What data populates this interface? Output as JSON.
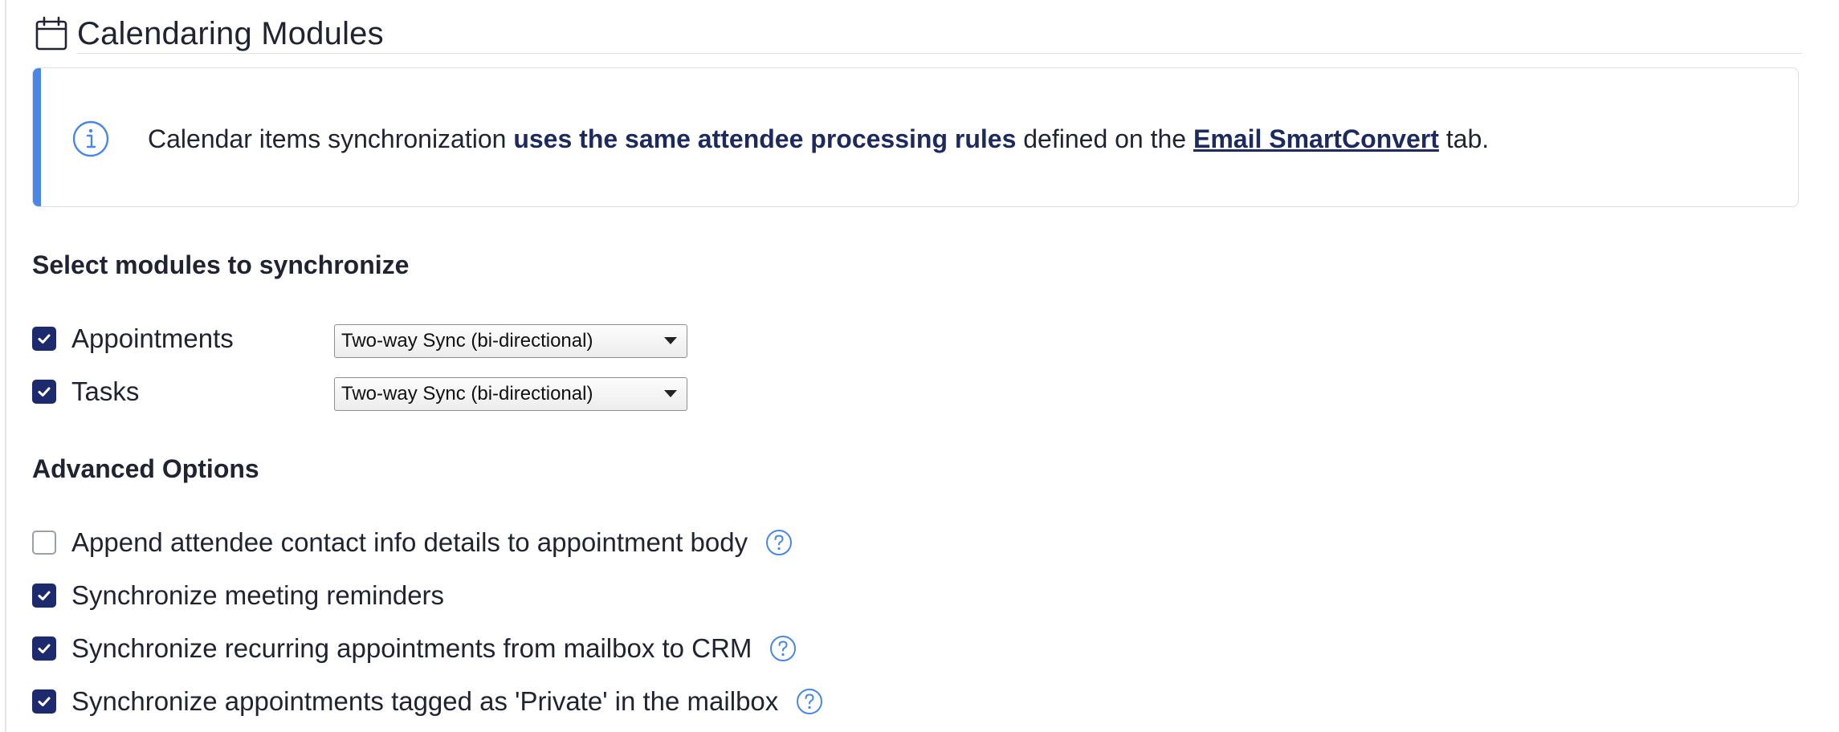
{
  "header": {
    "title": "Calendaring Modules",
    "icon": "calendar-icon"
  },
  "callout": {
    "icon": "info-icon",
    "text_before": "Calendar items synchronization ",
    "text_bold": "uses the same attendee processing rules",
    "text_middle": " defined on the ",
    "link_text": "Email SmartConvert",
    "text_after": " tab.",
    "accent_color": "#4a86e8"
  },
  "modules": {
    "heading": "Select modules to synchronize",
    "items": [
      {
        "label": "Appointments",
        "checked": true,
        "sync_mode": "Two-way Sync (bi-directional)"
      },
      {
        "label": "Tasks",
        "checked": true,
        "sync_mode": "Two-way Sync (bi-directional)"
      }
    ]
  },
  "advanced": {
    "heading": "Advanced Options",
    "items": [
      {
        "label": "Append attendee contact info details to appointment body",
        "checked": false,
        "help": true
      },
      {
        "label": "Synchronize meeting reminders",
        "checked": true,
        "help": false
      },
      {
        "label": "Synchronize recurring appointments from mailbox to CRM",
        "checked": true,
        "help": true
      },
      {
        "label": "Synchronize appointments tagged as 'Private' in the mailbox",
        "checked": true,
        "help": true
      }
    ]
  },
  "colors": {
    "checkbox_checked": "#1e2a6e",
    "link": "#1c2a5c",
    "help_icon": "#4a86e8"
  }
}
